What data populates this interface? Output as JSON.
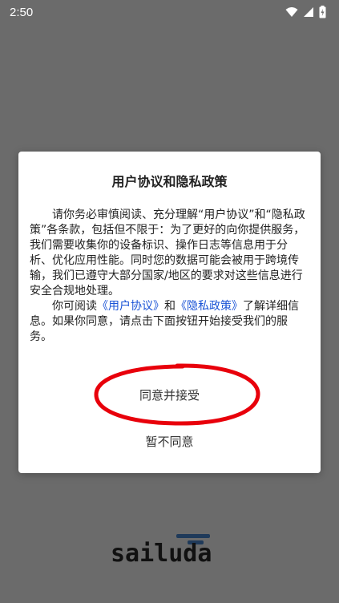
{
  "status_bar": {
    "time": "2:50",
    "icons": [
      "wifi-icon",
      "signal-icon",
      "battery-charging-icon"
    ]
  },
  "dialog": {
    "title": "用户协议和隐私政策",
    "para1": "请你务必审慎阅读、充分理解“用户协议”和“隐私政策”各条款，包括但不限于：为了更好的向你提供服务，我们需要收集你的设备标识、操作日志等信息用于分析、优化应用性能。同时您的数据可能会被用于跨境传输，我们已遵守大部分国家/地区的要求对这些信息进行安全合规地处理。",
    "para2_prefix": "你可阅读",
    "link_user_agreement": "《用户协议》",
    "para2_and": "和",
    "link_privacy_policy": "《隐私政策》",
    "para2_suffix": "了解详细信息。如果你同意，请点击下面按钮开始接受我们的服务。",
    "accept_label": "同意并接受",
    "decline_label": "暂不同意"
  },
  "logo": {
    "text": "sailuda"
  },
  "colors": {
    "overlay_background": "#6b6b6b",
    "dialog_background": "#ffffff",
    "link": "#1a53d6",
    "annotation_circle": "#e8000b"
  }
}
